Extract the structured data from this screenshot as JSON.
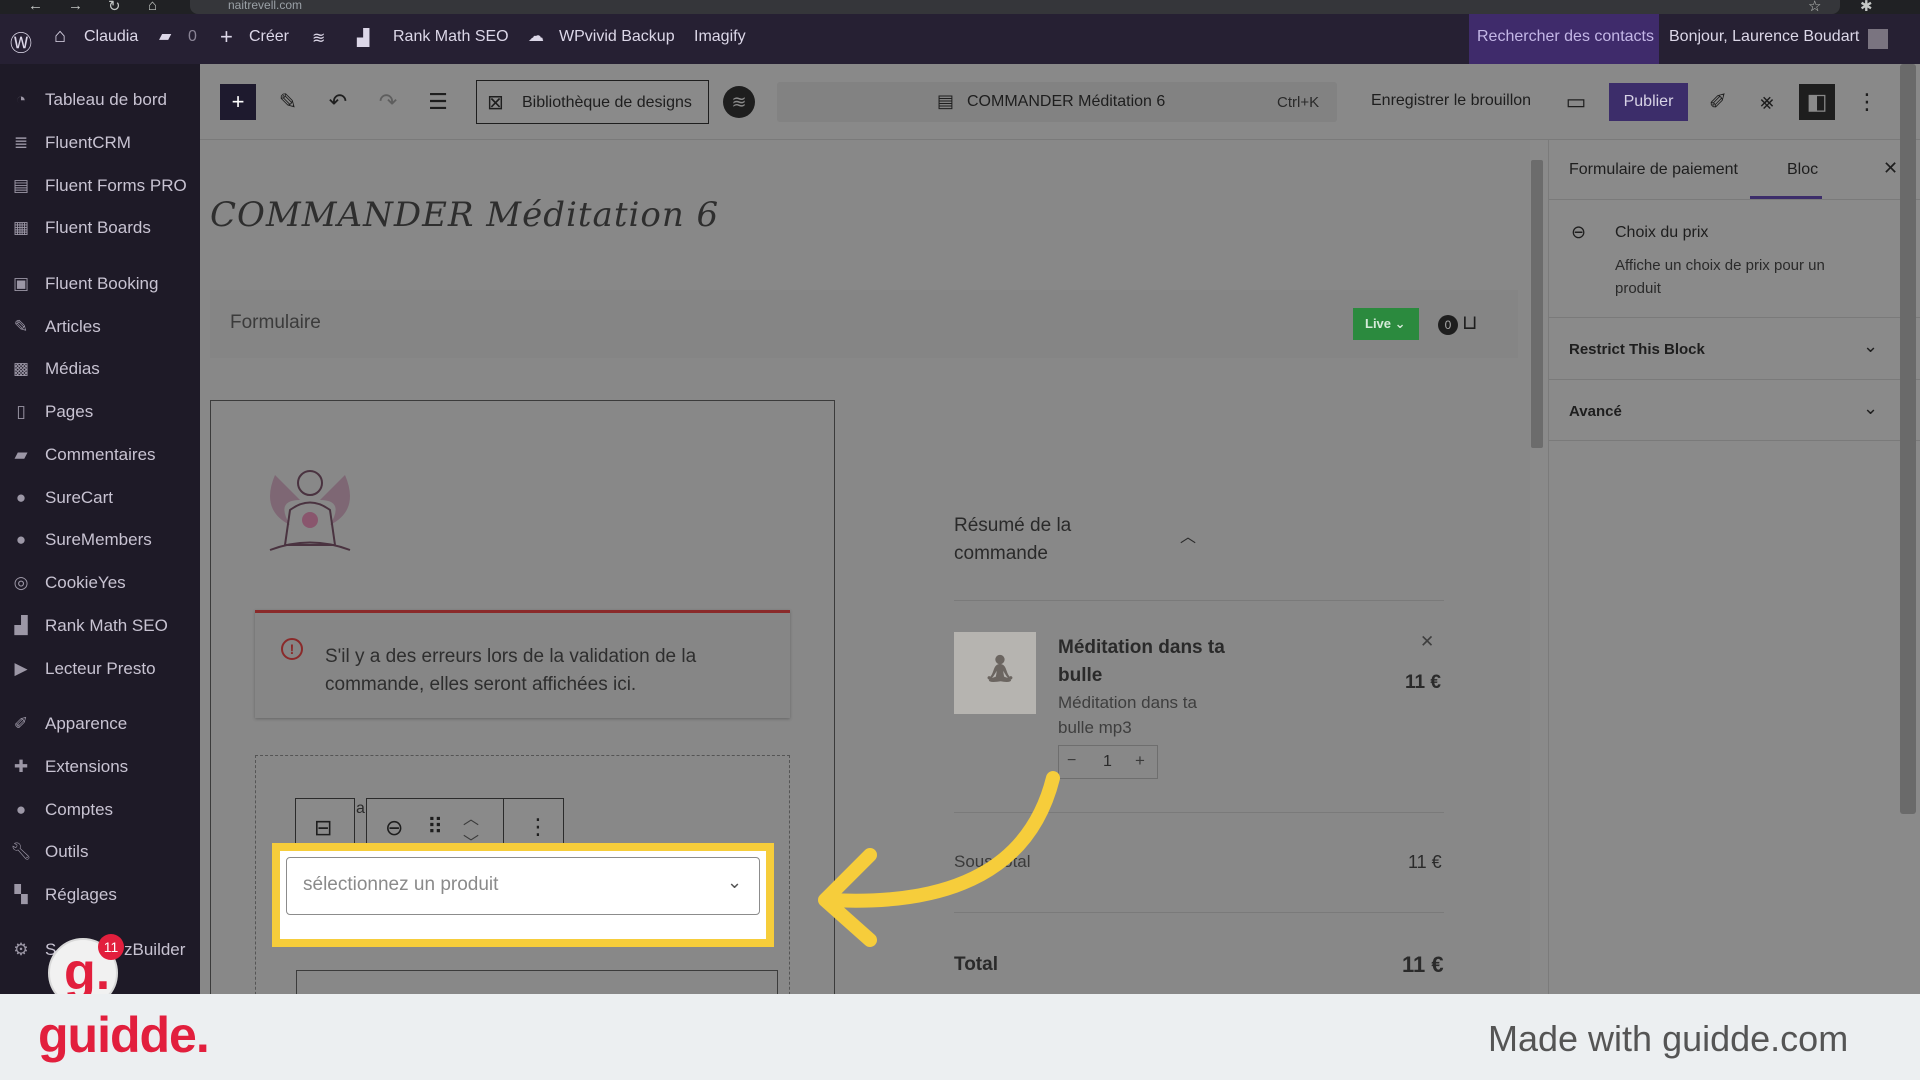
{
  "browser": {
    "url": "naitrevell.com"
  },
  "admin_bar": {
    "site_name": "Claudia",
    "comments_count": "0",
    "create": "Créer",
    "rank_math": "Rank Math SEO",
    "wpvivid": "WPvivid Backup",
    "imagify": "Imagify",
    "search_contacts": "Rechercher des contacts",
    "greeting": "Bonjour, Laurence Boudart"
  },
  "sidebar": {
    "items": [
      {
        "label": "Tableau de bord",
        "icon": "dashboard-icon"
      },
      {
        "label": "FluentCRM",
        "icon": "fluentcrm-icon"
      },
      {
        "label": "Fluent Forms PRO",
        "icon": "forms-icon"
      },
      {
        "label": "Fluent Boards",
        "icon": "boards-icon"
      },
      {
        "label": "Fluent Booking",
        "icon": "booking-icon"
      },
      {
        "label": "Articles",
        "icon": "pin-icon"
      },
      {
        "label": "Médias",
        "icon": "media-icon"
      },
      {
        "label": "Pages",
        "icon": "page-icon"
      },
      {
        "label": "Commentaires",
        "icon": "comment-icon"
      },
      {
        "label": "SureCart",
        "icon": "surecart-icon"
      },
      {
        "label": "SureMembers",
        "icon": "suremembers-icon"
      },
      {
        "label": "CookieYes",
        "icon": "cookie-icon"
      },
      {
        "label": "Rank Math SEO",
        "icon": "rankmath-icon"
      },
      {
        "label": "Lecteur Presto",
        "icon": "presto-icon"
      },
      {
        "label": "Apparence",
        "icon": "brush-icon"
      },
      {
        "label": "Extensions",
        "icon": "plugin-icon"
      },
      {
        "label": "Comptes",
        "icon": "user-icon"
      },
      {
        "label": "Outils",
        "icon": "wrench-icon"
      },
      {
        "label": "Réglages",
        "icon": "settings-icon"
      },
      {
        "label": "S",
        "icon": "gear-icon"
      }
    ],
    "extra_text": "zBuilder",
    "badge_count": "11"
  },
  "editor_header": {
    "design_library": "Bibliothèque de designs",
    "doc_title": "COMMANDER Méditation 6",
    "shortcut": "Ctrl+K",
    "save_draft": "Enregistrer le brouillon",
    "publish": "Publier"
  },
  "canvas": {
    "page_title": "COMMANDER Méditation 6",
    "form_label": "Formulaire",
    "live_label": "Live",
    "cart_count": "0",
    "error_text": "S'il y a des erreurs lors de la validation de la commande, elles seront affichées ici.",
    "select_placeholder": "sélectionnez un produit",
    "toolbar_letter": "a",
    "summary_title": "Résumé de la commande",
    "product_name": "Méditation dans ta bulle",
    "product_variant": "Méditation dans ta bulle mp3",
    "product_price": "11 €",
    "quantity": "1",
    "subtotal_label": "Sous-total",
    "subtotal_value": "11 €",
    "total_label": "Total",
    "total_value": "11 €"
  },
  "right_panel": {
    "tab_form": "Formulaire de paiement",
    "tab_block": "Bloc",
    "block_title": "Choix du prix",
    "block_desc": "Affiche un choix de prix pour un produit",
    "restrict": "Restrict This Block",
    "advanced": "Avancé"
  },
  "footer": {
    "logo": "guidde.",
    "made_with": "Made with guidde.com"
  },
  "colors": {
    "admin_bar": "#262033",
    "sidebar": "#1e1a27",
    "highlight": "#f6cd3b",
    "publish": "#3c2d6a",
    "live": "#2b8a3e",
    "logo": "#e21f3d"
  }
}
